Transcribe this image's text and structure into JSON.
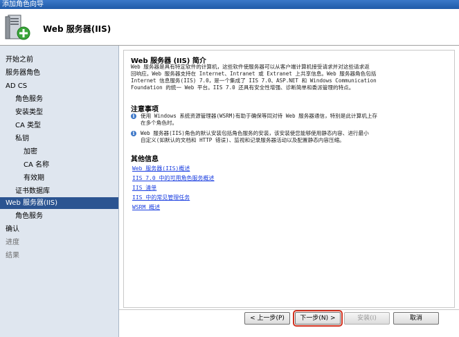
{
  "window": {
    "title": "添加角色向导"
  },
  "header": {
    "title": "Web 服务器(IIS)",
    "icon": "server-add-icon"
  },
  "sidebar": {
    "items": [
      {
        "label": "开始之前",
        "indent": 0,
        "state": "normal"
      },
      {
        "label": "服务器角色",
        "indent": 0,
        "state": "normal"
      },
      {
        "label": "AD CS",
        "indent": 0,
        "state": "normal"
      },
      {
        "label": "角色服务",
        "indent": 1,
        "state": "normal"
      },
      {
        "label": "安装类型",
        "indent": 1,
        "state": "normal"
      },
      {
        "label": "CA 类型",
        "indent": 1,
        "state": "normal"
      },
      {
        "label": "私钥",
        "indent": 1,
        "state": "normal"
      },
      {
        "label": "加密",
        "indent": 2,
        "state": "normal"
      },
      {
        "label": "CA 名称",
        "indent": 2,
        "state": "normal"
      },
      {
        "label": "有效期",
        "indent": 2,
        "state": "normal"
      },
      {
        "label": "证书数据库",
        "indent": 1,
        "state": "normal"
      },
      {
        "label": "Web 服务器(IIS)",
        "indent": 0,
        "state": "selected"
      },
      {
        "label": "角色服务",
        "indent": 1,
        "state": "normal"
      },
      {
        "label": "确认",
        "indent": 0,
        "state": "normal"
      },
      {
        "label": "进度",
        "indent": 0,
        "state": "dim"
      },
      {
        "label": "结果",
        "indent": 0,
        "state": "dim"
      }
    ]
  },
  "intro": {
    "title": "Web 服务器 (IIS) 简介",
    "lines": [
      "Web 服务器是具有特定软件的计算机，这些软件使服务器可以从客户端计算机接受请求并对这些请求返",
      "回响应。Web 服务器支持在 Internet、Intranet 或 Extranet 上共享信息。Web 服务器角色包括",
      "Internet 信息服务(IIS) 7.0，是一个集成了 IIS 7.0、ASP.NET 和 Windows Communication",
      "Foundation 的统一 Web 平台。IIS 7.0 还具有安全性增强、诊断简单和委派管理的特点。"
    ]
  },
  "notes": {
    "title": "注意事项",
    "items": [
      {
        "lines": [
          "使用 Windows 系统资源管理器(WSRM)有助于确保等同对待 Web 服务器通信，特别是此计算机上存",
          "在多个角色时。"
        ]
      },
      {
        "lines": [
          "Web 服务器(IIS)角色的默认安装包括角色服务的安装，该安装使您能够使用静态内容、进行最小",
          "自定义(如默认的文档和 HTTP 错误)、监视和记录服务器活动以及配置静态内容压缩。"
        ]
      }
    ]
  },
  "more_info": {
    "title": "其他信息",
    "links": [
      "Web 服务器(IIS)概述",
      "IIS 7.0 中的可用角色服务概述",
      "IIS 清单",
      "IIS 中的常见管理任务",
      "WSRM 概述"
    ]
  },
  "buttons": {
    "prev": "< 上一步(P)",
    "next": "下一步(N) >",
    "install": "安装(I)",
    "cancel": "取消"
  },
  "colors": {
    "sidebar_bg": "#dfe6ef",
    "selected_bg": "#2b5491",
    "link": "#1a3ee0",
    "highlight_outline": "#d0301e"
  }
}
